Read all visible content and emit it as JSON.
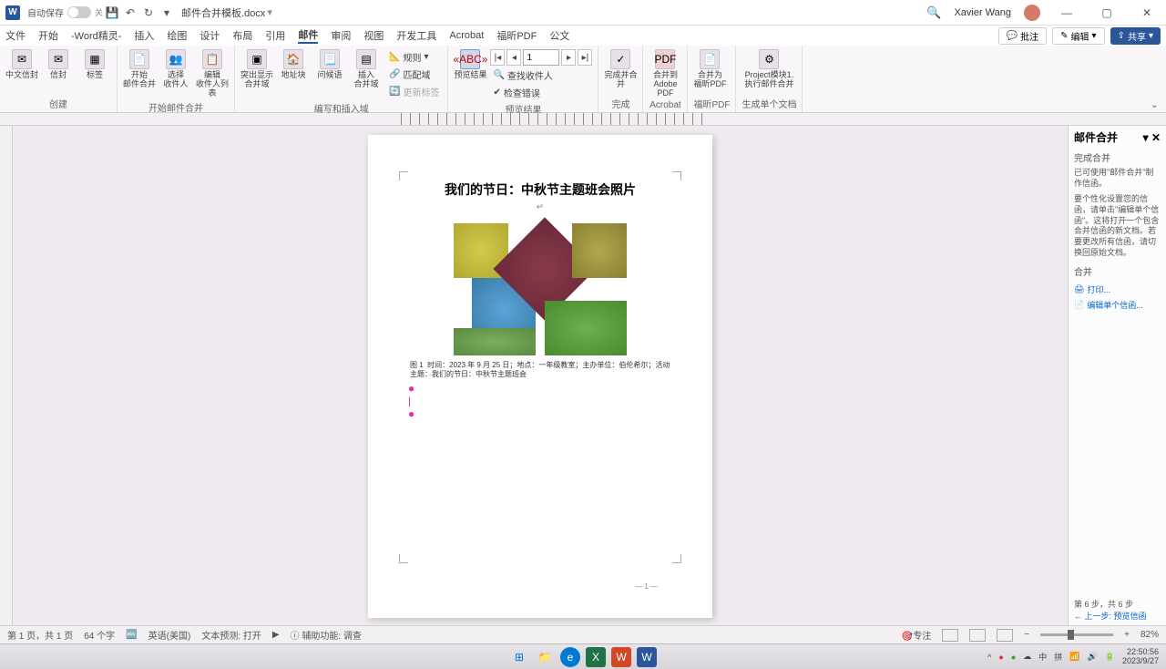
{
  "titlebar": {
    "autosave_label": "自动保存",
    "toggle_state": "关",
    "doc_name": "邮件合并模板.docx",
    "user": "Xavier Wang"
  },
  "tabs": {
    "items": [
      "文件",
      "开始",
      "-Word精灵-",
      "插入",
      "绘图",
      "设计",
      "布局",
      "引用",
      "邮件",
      "审阅",
      "视图",
      "开发工具",
      "Acrobat",
      "福昕PDF",
      "公文"
    ],
    "active_index": 8,
    "comment_btn": "批注",
    "edit_btn": "编辑",
    "share_btn": "共享"
  },
  "ribbon": {
    "group_create": {
      "label": "创建",
      "btn_chinese_env": "中文信封",
      "btn_env": "信封",
      "btn_label": "标签"
    },
    "group_start": {
      "label": "开始邮件合并",
      "btn_start": "开始\n邮件合并",
      "btn_select": "选择\n收件人",
      "btn_edit": "编辑\n收件人列表"
    },
    "group_write": {
      "label": "编写和插入域",
      "btn_highlight": "突出显示\n合并域",
      "btn_address": "地址块",
      "btn_greeting": "问候语",
      "btn_insert": "插入\n合并域",
      "rules": "规则",
      "match": "匹配域",
      "update": "更新标签"
    },
    "group_preview": {
      "label": "预览结果",
      "btn_preview": "预览结果",
      "record_value": "1",
      "find": "查找收件人",
      "check": "检查错误"
    },
    "group_finish": {
      "label": "完成",
      "btn_finish": "完成并合并"
    },
    "group_acrobat": {
      "label": "Acrobat",
      "btn_merge_pdf": "合并到\nAdobe PDF"
    },
    "group_foxit": {
      "label": "福昕PDF",
      "btn_foxit": "合并为\n福昕PDF"
    },
    "group_project": {
      "label": "生成单个文档",
      "line1": "Project模块1.",
      "line2": "执行邮件合并"
    }
  },
  "document": {
    "heading": "我们的节日：中秋节主题班会照片",
    "caption": "图 1  时间：2023 年 9 月 25 日；地点：一年级教室；主办单位：伯伦希尔；活动主题：我们的节日：中秋节主题班会",
    "page_number": "1"
  },
  "sidepane": {
    "title": "邮件合并",
    "sec1": "完成合并",
    "text1": "已可使用\"邮件合并\"制作信函。",
    "text2": "要个性化设置您的信函，请单击\"编辑单个信函\"。这将打开一个包含合并信函的新文档。若要更改所有信函，请切换回原始文档。",
    "sec2": "合并",
    "link_print": "打印...",
    "link_edit": "编辑单个信函...",
    "step_label": "第 6 步，共 6 步",
    "prev_label": "上一步: 预览信函"
  },
  "statusbar": {
    "page": "第 1 页，共 1 页",
    "words": "64 个字",
    "lang": "英语(美国)",
    "predict": "文本预测: 打开",
    "access": "辅助功能: 调查",
    "focus": "专注",
    "zoom": "82%"
  },
  "taskbar": {
    "time": "22:50:56",
    "date": "2023/9/27"
  }
}
